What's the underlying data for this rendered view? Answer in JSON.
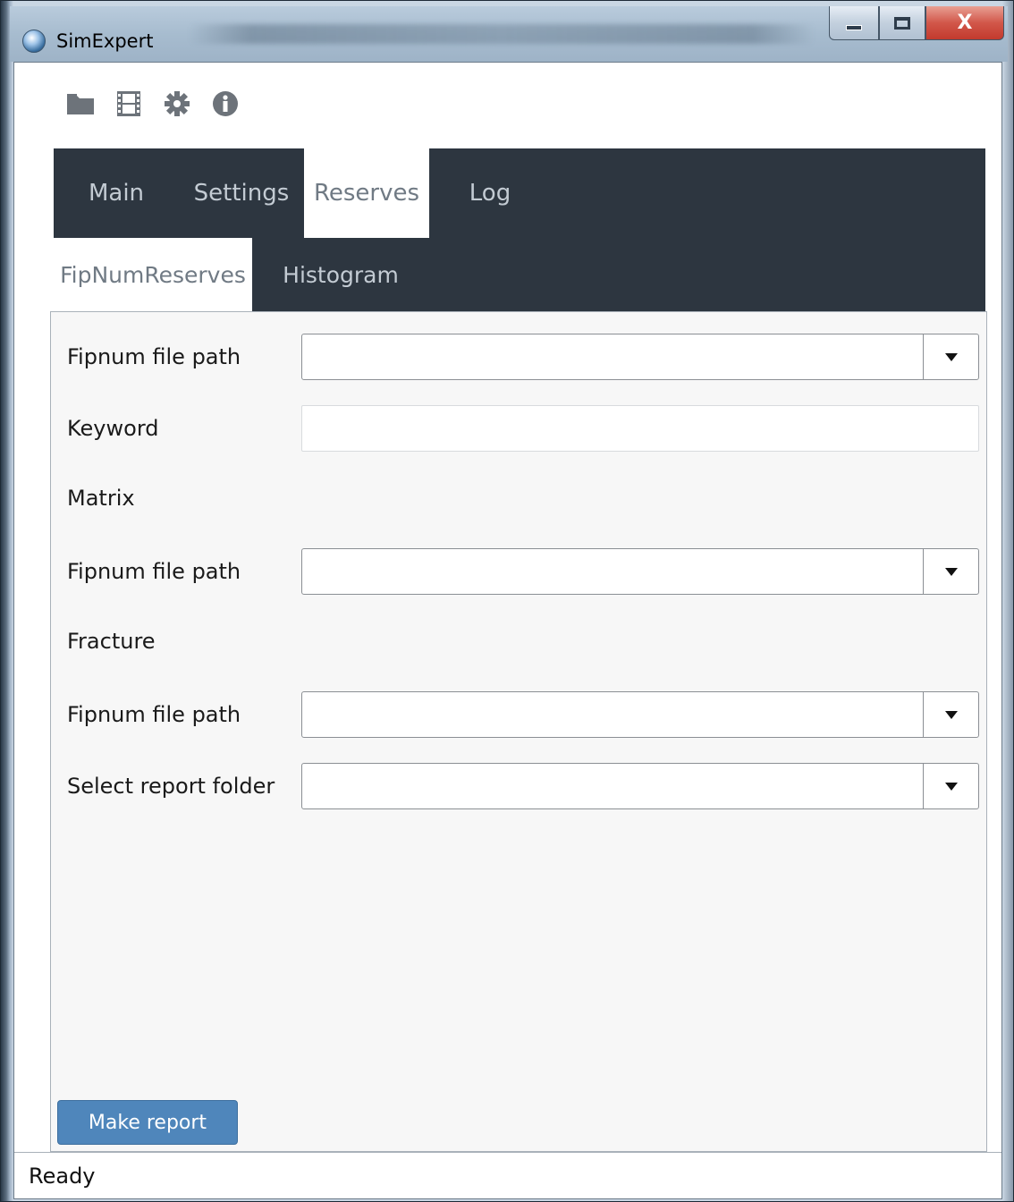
{
  "window": {
    "title": "SimExpert",
    "controls": {
      "minimize": "minimize",
      "maximize": "maximize",
      "close": "X"
    }
  },
  "toolbar": {
    "icons": [
      "folder-icon",
      "film-icon",
      "gear-icon",
      "info-icon"
    ]
  },
  "tabs": [
    {
      "label": "Main",
      "active": false
    },
    {
      "label": "Settings",
      "active": false
    },
    {
      "label": "Reserves",
      "active": true
    },
    {
      "label": "Log",
      "active": false
    }
  ],
  "subtabs": [
    {
      "label": "FipNumReserves",
      "active": true
    },
    {
      "label": "Histogram",
      "active": false
    }
  ],
  "form": {
    "fipnum_path_label": "Fipnum file path",
    "fipnum_path_value": "",
    "keyword_label": "Keyword",
    "keyword_value": "",
    "matrix_label": "Matrix",
    "matrix_fipnum_label": "Fipnum file path",
    "matrix_fipnum_value": "",
    "fracture_label": "Fracture",
    "fracture_fipnum_label": "Fipnum file path",
    "fracture_fipnum_value": "",
    "report_folder_label": "Select report folder",
    "report_folder_value": ""
  },
  "actions": {
    "make_report": "Make report"
  },
  "status": {
    "text": "Ready"
  },
  "colors": {
    "tab_bar": "#2d3640",
    "button_blue": "#4f86bb",
    "panel_bg": "#f7f7f7"
  }
}
